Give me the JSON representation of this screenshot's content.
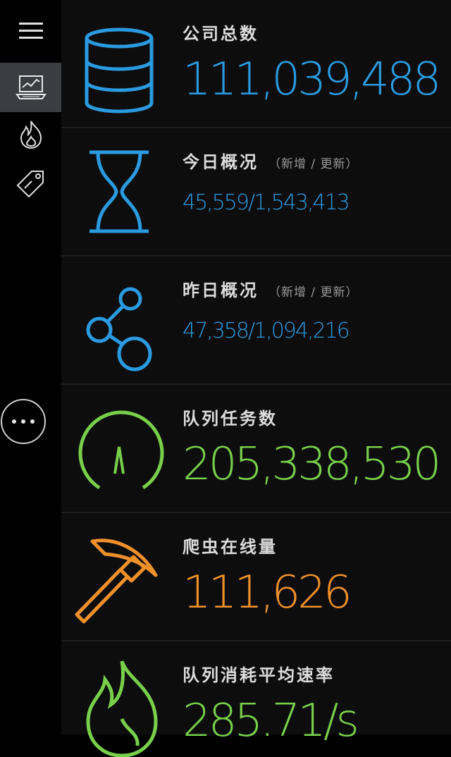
{
  "colors": {
    "blue": "#2a9be0",
    "green": "#78d04a",
    "orange": "#f0902a"
  },
  "sidebar": {
    "items": [
      {
        "icon": "menu-icon"
      },
      {
        "icon": "laptop-chart-icon",
        "active": true
      },
      {
        "icon": "flame-icon"
      },
      {
        "icon": "tag-icon"
      }
    ],
    "more_icon": "more-dots-icon"
  },
  "cards": [
    {
      "icon": "database-icon",
      "label": "公司总数",
      "value": "111,039,488"
    },
    {
      "icon": "hourglass-icon",
      "label": "今日概况",
      "sub": "（新增 / 更新）",
      "value": "45,559/1,543,413"
    },
    {
      "icon": "share-nodes-icon",
      "label": "昨日概况",
      "sub": "（新增 / 更新）",
      "value": "47,358/1,094,216"
    },
    {
      "icon": "speedometer-icon",
      "label": "队列任务数",
      "value": "205,338,530"
    },
    {
      "icon": "pickaxe-icon",
      "label": "爬虫在线量",
      "value": "111,626"
    },
    {
      "icon": "flame-icon",
      "label": "队列消耗平均速率",
      "value": "285.71/s"
    }
  ]
}
